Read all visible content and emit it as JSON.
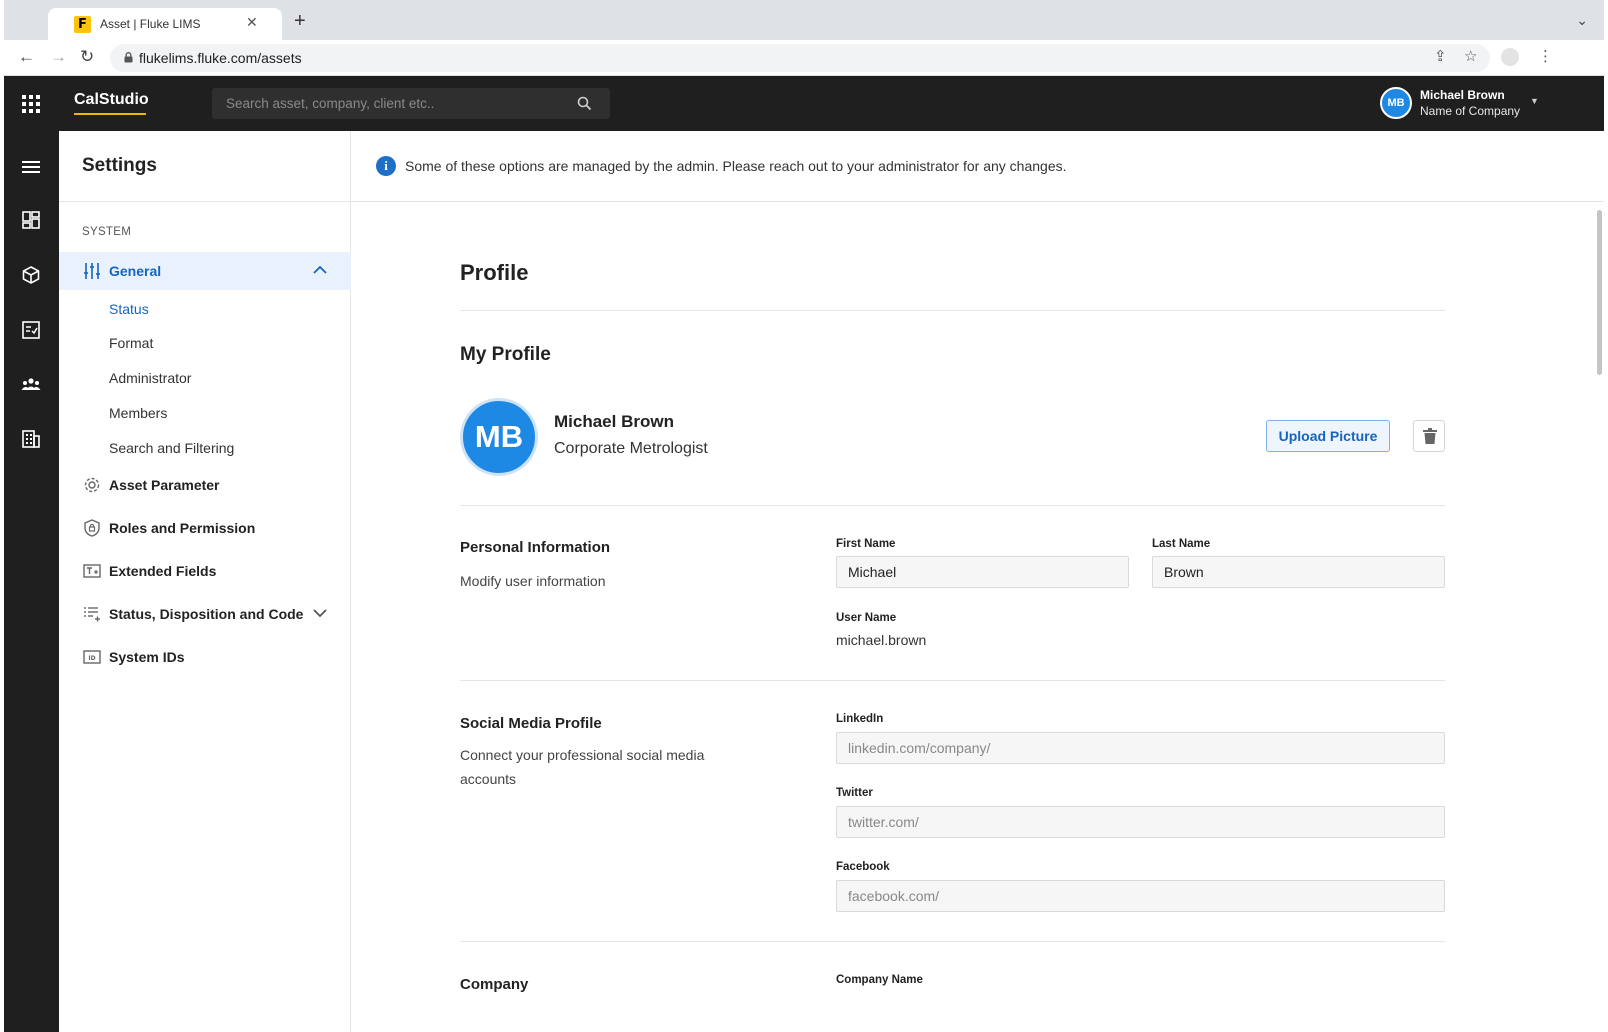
{
  "browser": {
    "tab_title": "Asset | Fluke LIMS",
    "tab_favicon_letter": "F",
    "url": "flukelims.fluke.com/assets"
  },
  "header": {
    "brand": "CalStudio",
    "search_placeholder": "Search asset, company, client etc..",
    "user_initials": "MB",
    "user_name": "Michael Brown",
    "user_company": "Name of Company"
  },
  "rail": {
    "icons": [
      "menu-icon",
      "dashboard-icon",
      "asset-box-icon",
      "checklist-icon",
      "people-icon",
      "building-icon"
    ]
  },
  "sidebar": {
    "title": "Settings",
    "section_label": "SYSTEM",
    "general": {
      "label": "General",
      "sub_items": [
        "Status",
        "Format",
        "Administrator",
        "Members",
        "Search and Filtering"
      ]
    },
    "items": [
      {
        "label": "Asset Parameter"
      },
      {
        "label": "Roles and Permission"
      },
      {
        "label": "Extended Fields"
      },
      {
        "label": "Status, Disposition and Code"
      },
      {
        "label": "System IDs"
      }
    ]
  },
  "banner": {
    "text": "Some of these options are managed by the admin. Please reach out to your administrator for any changes."
  },
  "profile": {
    "heading": "Profile",
    "my_profile_heading": "My Profile",
    "avatar_initials": "MB",
    "name": "Michael Brown",
    "role": "Corporate Metrologist",
    "upload_label": "Upload Picture",
    "personal": {
      "title": "Personal Information",
      "desc": "Modify user information",
      "first_name_label": "First Name",
      "first_name_value": "Michael",
      "last_name_label": "Last Name",
      "last_name_value": "Brown",
      "username_label": "User Name",
      "username_value": "michael.brown"
    },
    "social": {
      "title": "Social Media Profile",
      "desc": "Connect your professional social media accounts",
      "linkedin_label": "LinkedIn",
      "linkedin_placeholder": "linkedin.com/company/",
      "twitter_label": "Twitter",
      "twitter_placeholder": "twitter.com/",
      "facebook_label": "Facebook",
      "facebook_placeholder": "facebook.com/"
    },
    "company": {
      "title": "Company",
      "company_name_label": "Company Name"
    }
  },
  "colors": {
    "accent": "#1565c0",
    "brand_underline": "#f4b400",
    "avatar": "#1e88e5",
    "dark_bar": "#1f1f1f"
  }
}
